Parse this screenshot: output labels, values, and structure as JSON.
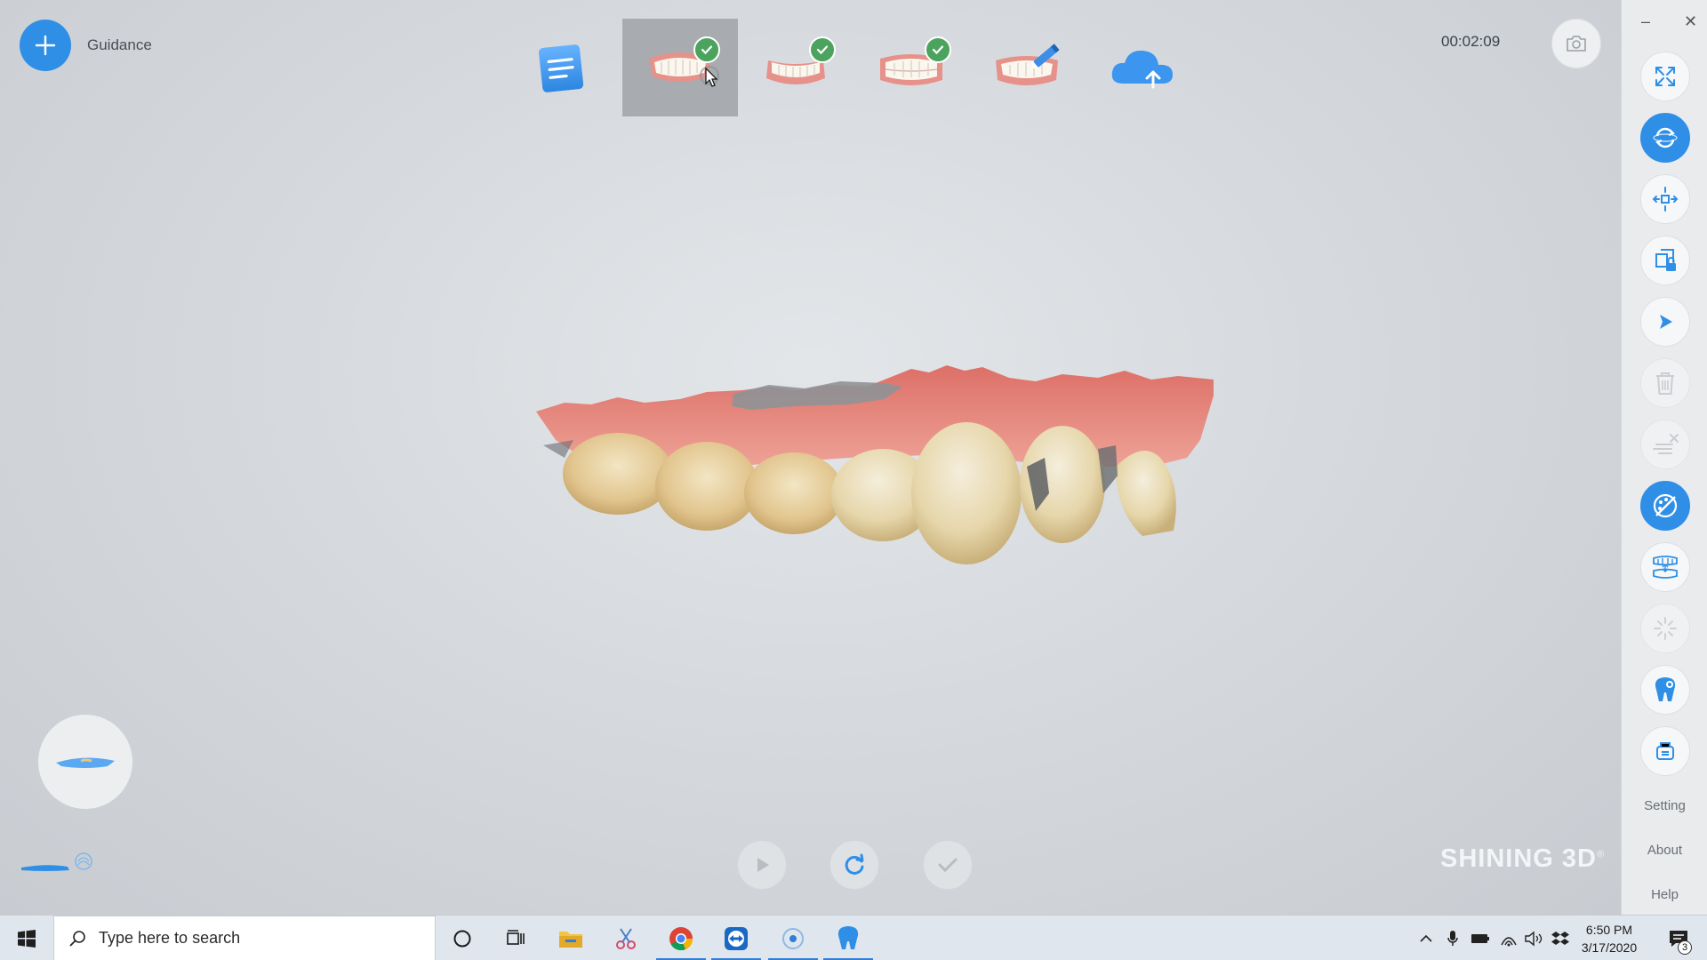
{
  "header": {
    "guidance_label": "Guidance",
    "timer": "00:02:09"
  },
  "steps": [
    {
      "name": "order-notes",
      "icon": "notepad-icon",
      "completed": false
    },
    {
      "name": "upper-jaw-scan",
      "icon": "upper-jaw-icon",
      "completed": true,
      "active": true
    },
    {
      "name": "lower-jaw-scan",
      "icon": "lower-jaw-icon",
      "completed": true
    },
    {
      "name": "bite-scan",
      "icon": "bite-icon",
      "completed": true
    },
    {
      "name": "edit-model",
      "icon": "jaw-edit-icon",
      "completed": false
    },
    {
      "name": "cloud-upload",
      "icon": "cloud-upload-icon",
      "completed": false
    }
  ],
  "right_panel": {
    "links": {
      "setting": "Setting",
      "about": "About",
      "help": "Help"
    },
    "tools": [
      "fullscreen-icon",
      "rotate-icon",
      "pan-icon",
      "lock-area-icon",
      "select-icon",
      "trash-icon",
      "erase-icon",
      "texture-icon",
      "bite-align-icon",
      "brush-icon",
      "tooth-icon",
      "scanner-tip-icon"
    ]
  },
  "branding": {
    "name": "SHINING 3D",
    "mark": "®"
  },
  "colors": {
    "accent": "#2f8fe6",
    "check": "#4ca35e",
    "gum": "#e0857c",
    "tooth": "#e6cf9a"
  },
  "taskbar": {
    "search_placeholder": "Type here to search",
    "time": "6:50 PM",
    "date": "3/17/2020",
    "notification_count": "3"
  }
}
